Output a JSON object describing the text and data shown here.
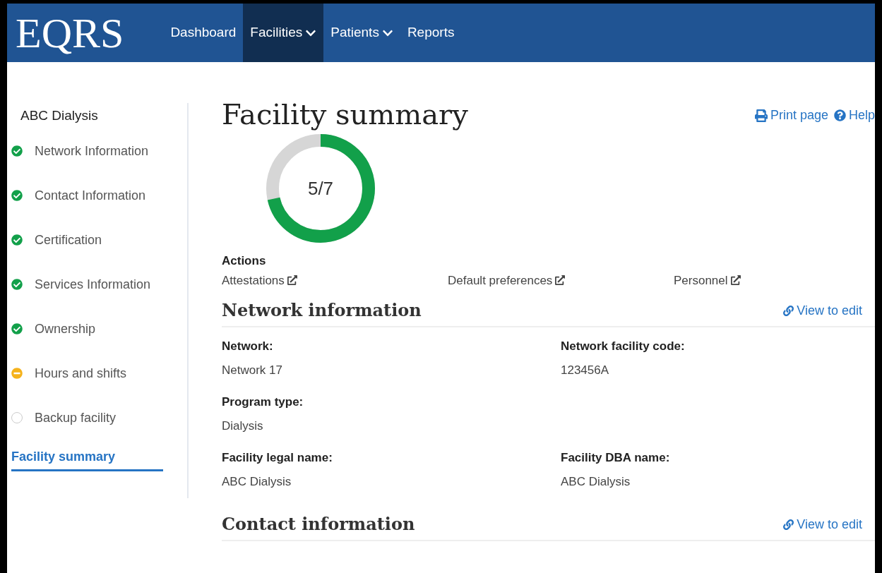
{
  "header": {
    "logo": "EQRS",
    "nav": [
      {
        "label": "Dashboard",
        "selected": false,
        "dropdown": false
      },
      {
        "label": "Facilities",
        "selected": true,
        "dropdown": true
      },
      {
        "label": "Patients",
        "selected": false,
        "dropdown": true
      },
      {
        "label": "Reports",
        "selected": false,
        "dropdown": false
      }
    ]
  },
  "sidebar": {
    "title": "ABC Dialysis",
    "items": [
      {
        "label": "Network Information",
        "kind": "complete"
      },
      {
        "label": "Contact Information",
        "kind": "complete"
      },
      {
        "label": "Certification",
        "kind": "complete"
      },
      {
        "label": "Services Information",
        "kind": "complete"
      },
      {
        "label": "Ownership",
        "kind": "complete"
      },
      {
        "label": "Hours and shifts",
        "kind": "partial"
      },
      {
        "label": "Backup facility",
        "kind": "empty"
      }
    ],
    "current": {
      "label": "Facility summary",
      "selected": true
    }
  },
  "main": {
    "title": "Facility summary",
    "links": [
      {
        "label": "Print page",
        "kind": "print"
      },
      {
        "label": "Help",
        "kind": "help"
      }
    ],
    "progress": {
      "label": "5/7"
    },
    "actions": {
      "title": "Actions",
      "links": [
        "Attestations",
        "Default preferences",
        "Personnel"
      ]
    },
    "sections": [
      {
        "title": "Network information",
        "edit": "View to edit",
        "rows": [
          [
            {
              "label": "Network:",
              "value": "Network 17"
            },
            {
              "label": "Network facility code:",
              "value": "123456A"
            }
          ],
          [
            {
              "label": "Program type:",
              "value": "Dialysis"
            }
          ],
          [
            {
              "label": "Facility legal name:",
              "value": "ABC Dialysis"
            },
            {
              "label": "Facility DBA name:",
              "value": "ABC Dialysis"
            }
          ]
        ]
      },
      {
        "title": "Contact information",
        "edit": "View to edit"
      }
    ]
  }
}
